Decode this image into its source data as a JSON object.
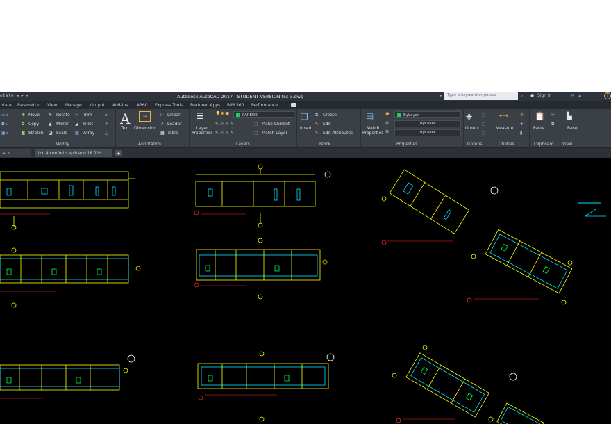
{
  "titlebar": {
    "quick_access": "otate  ◂ ▸ ▾",
    "app_title": "Autodesk AutoCAD 2017 - STUDENT VERSION    tcc 3.dwg",
    "search_placeholder": "Type a keyword or phrase",
    "sign_in": "Sign In",
    "help": "?"
  },
  "ribbon_tabs": [
    "otate",
    "Parametric",
    "View",
    "Manage",
    "Output",
    "Add-ins",
    "A360",
    "Express Tools",
    "Featured Apps",
    "BIM 360",
    "Performance"
  ],
  "ribbon": {
    "modify": {
      "move": "Move",
      "rotate": "Rotate",
      "trim": "Trim",
      "copy": "Copy",
      "mirror": "Mirror",
      "fillet": "Fillet",
      "stretch": "Stretch",
      "scale": "Scale",
      "array": "Array",
      "panel": "Modify"
    },
    "annotation": {
      "text": "Text",
      "dimension": "Dimension",
      "linear": "Linear",
      "leader": "Leader",
      "table": "Table",
      "panel": "Annotation"
    },
    "layers": {
      "layer_properties": "Layer\nProperties",
      "current_layer": "PAREDE",
      "make_current": "Make Current",
      "match_layer": "Match Layer",
      "panel": "Layers"
    },
    "block": {
      "insert": "Insert",
      "create": "Create",
      "edit": "Edit",
      "edit_attributes": "Edit Attributes",
      "panel": "Block"
    },
    "properties": {
      "match_properties": "Match\nProperties",
      "color": "ByLayer",
      "linetype": "ByLayer",
      "lineweight": "ByLayer",
      "panel": "Properties"
    },
    "groups": {
      "group": "Group",
      "panel": "Groups"
    },
    "utilities": {
      "measure": "Measure",
      "panel": "Utilities"
    },
    "clipboard": {
      "paste": "Paste",
      "panel": "Clipboard"
    },
    "view": {
      "base": "Base",
      "panel": "View"
    }
  },
  "file_tabs": [
    {
      "label": "tcc 4 conforto aplicado 18.11*",
      "active": true
    }
  ],
  "colors": {
    "canvas": "#000000",
    "drawing_yellow": "#ffff00",
    "drawing_cyan": "#00e5ff",
    "drawing_green": "#00ff44",
    "annotation_red": "#ff2a1f",
    "layer_green": "#19d15a"
  }
}
